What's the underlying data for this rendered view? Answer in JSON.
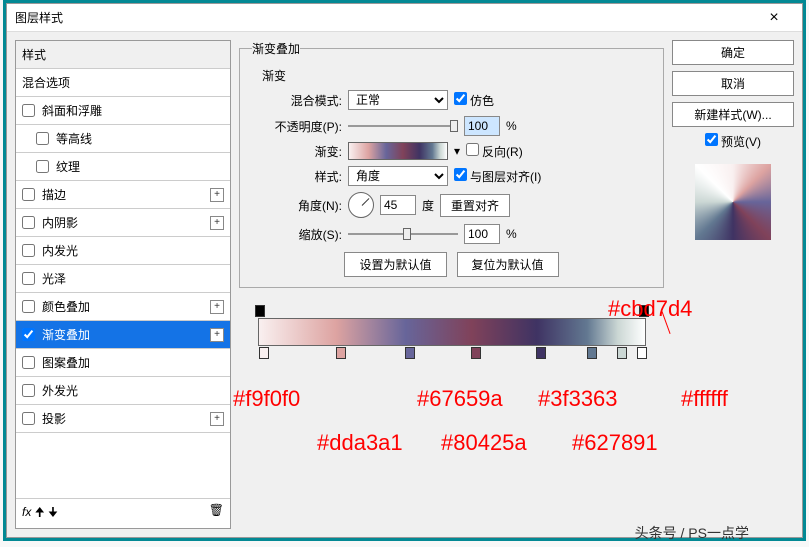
{
  "title": "图层样式",
  "sidebar": {
    "header": "样式",
    "blend": "混合选项",
    "bevel": "斜面和浮雕",
    "contour": "等高线",
    "texture": "纹理",
    "stroke": "描边",
    "innerShadow": "内阴影",
    "innerGlow": "内发光",
    "satin": "光泽",
    "colorOverlay": "颜色叠加",
    "gradientOverlay": "渐变叠加",
    "patternOverlay": "图案叠加",
    "outerGlow": "外发光",
    "dropShadow": "投影",
    "fxLabel": "fx"
  },
  "section": {
    "title": "渐变叠加",
    "subtitle": "渐变",
    "blendModeLabel": "混合模式:",
    "blendModeValue": "正常",
    "dither": "仿色",
    "opacityLabel": "不透明度(P):",
    "opacityValue": "100",
    "percent": "%",
    "gradientLabel": "渐变:",
    "reverse": "反向(R)",
    "styleLabel": "样式:",
    "styleValue": "角度",
    "alignLayer": "与图层对齐(I)",
    "angleLabel": "角度(N):",
    "angleValue": "45",
    "angleUnit": "度",
    "resetAlign": "重置对齐",
    "scaleLabel": "缩放(S):",
    "scaleValue": "100",
    "setDefault": "设置为默认值",
    "resetDefault": "复位为默认值"
  },
  "buttons": {
    "ok": "确定",
    "cancel": "取消",
    "newStyle": "新建样式(W)...",
    "preview": "预览(V)"
  },
  "annotations": {
    "c1": "#f9f0f0",
    "c2": "#dda3a1",
    "c3": "#67659a",
    "c4": "#80425a",
    "c5": "#3f3363",
    "c6": "#627891",
    "c7": "#cbd7d4",
    "c8": "#ffffff"
  },
  "footer": "头条号 / PS一点学",
  "chart_data": {
    "type": "gradient",
    "angle": 45,
    "stops": [
      {
        "color": "#f9f0f0",
        "position": 0
      },
      {
        "color": "#dda3a1",
        "position": 20
      },
      {
        "color": "#67659a",
        "position": 38
      },
      {
        "color": "#80425a",
        "position": 55
      },
      {
        "color": "#3f3363",
        "position": 72
      },
      {
        "color": "#627891",
        "position": 85
      },
      {
        "color": "#cbd7d4",
        "position": 93
      },
      {
        "color": "#ffffff",
        "position": 100
      }
    ]
  }
}
